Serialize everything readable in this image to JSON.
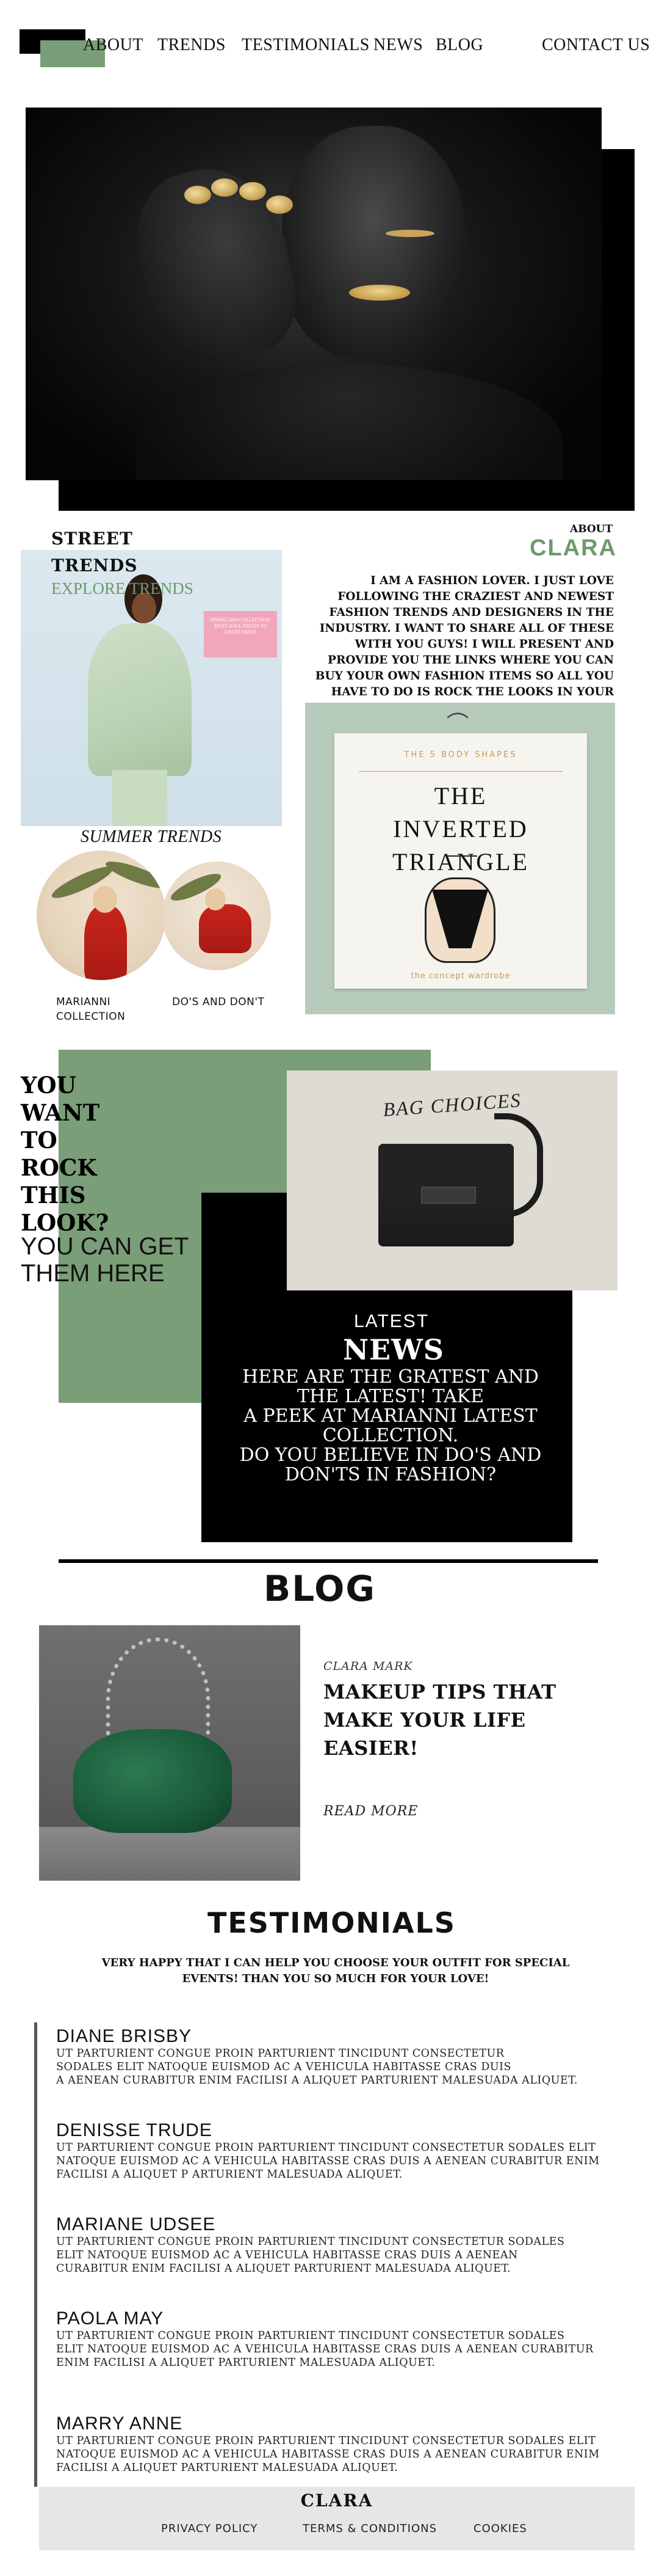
{
  "nav": {
    "items": [
      "ABOUT",
      "TRENDS",
      "TESTIMONIALS",
      "NEWS",
      "BLOG"
    ],
    "contact": "CONTACT US"
  },
  "street": {
    "title_line1": "STREET",
    "title_line2": "TRENDS",
    "explore": "EXPLORE TRENDS",
    "tag_text": "SPRING 2024 COLLECTION. MUST HAVE PIECES TO GREAT DRESS"
  },
  "summer": {
    "title": "SUMMER TRENDS",
    "items": [
      {
        "label_line1": "MARIANNI",
        "label_line2": "COLLECTION"
      },
      {
        "label_line1": "DO'S AND DON'T",
        "label_line2": ""
      }
    ]
  },
  "about": {
    "label": "ABOUT",
    "name": "CLARA",
    "text": "I AM A FASHION LOVER. I JUST LOVE FOLLOWING THE CRAZIEST AND NEWEST FASHION TRENDS AND DESIGNERS IN THE INDUSTRY. I WANT TO SHARE ALL OF THESE WITH YOU GUYS! I WILL PRESENT AND PROVIDE YOU THE LINKS WHERE YOU CAN BUY YOUR OWN FASHION ITEMS SO ALL YOU HAVE TO DO IS ROCK THE LOOKS IN YOUR OWN PERSONAL WAY!"
  },
  "body_shapes": {
    "small": "THE 5 BODY SHAPES",
    "title_line1": "THE",
    "title_line2": "INVERTED",
    "title_line3": "TRIANGLE",
    "footer": "the concept wardrobe"
  },
  "rock": {
    "lines": [
      "YOU",
      "WANT",
      "TO",
      "ROCK",
      "THIS",
      "LOOK?"
    ],
    "sub_line1": "YOU CAN GET",
    "sub_line2": "THEM HERE"
  },
  "bag": {
    "title": "BAG CHOICES"
  },
  "news": {
    "latest": "LATEST",
    "title": "NEWS",
    "line1": "HERE ARE THE GRATEST AND THE LATEST! TAKE",
    "line2": "A PEEK AT MARIANNI LATEST COLLECTION.",
    "line3": "DO YOU BELIEVE IN DO'S AND DON'TS IN FASHION?"
  },
  "blog": {
    "title": "BLOG",
    "author": "CLARA MARK",
    "headline": "MAKEUP TIPS THAT MAKE YOUR LIFE EASIER!",
    "read_more": "READ MORE"
  },
  "testimonials": {
    "title": "TESTIMONIALS",
    "intro": "VERY HAPPY THAT I CAN HELP YOU CHOOSE YOUR OUTFIT FOR SPECIAL EVENTS! THAN YOU SO MUCH FOR YOUR LOVE!",
    "items": [
      {
        "name": "DIANE BRISBY",
        "l1": "UT PARTURIENT CONGUE PROIN PARTURIENT TINCIDUNT CONSECTETUR",
        "l2": "SODALES ELIT NATOQUE EUISMOD AC A VEHICULA HABITASSE CRAS DUIS",
        "l3": "A AENEAN CURABITUR ENIM FACILISI A ALIQUET PARTURIENT MALESUADA ALIQUET."
      },
      {
        "name": "DENISSE TRUDE",
        "l1": "UT PARTURIENT CONGUE PROIN PARTURIENT TINCIDUNT CONSECTETUR SODALES ELIT",
        "l2": "NATOQUE EUISMOD AC A VEHICULA HABITASSE CRAS DUIS A AENEAN CURABITUR ENIM",
        "l3": "FACILISI A ALIQUET P ARTURIENT MALESUADA ALIQUET."
      },
      {
        "name": "MARIANE UDSEE",
        "l1": "UT PARTURIENT CONGUE PROIN PARTURIENT TINCIDUNT CONSECTETUR SODALES",
        "l2": " ELIT NATOQUE EUISMOD AC A VEHICULA HABITASSE CRAS DUIS A AENEAN",
        "l3": "CURABITUR ENIM FACILISI A ALIQUET PARTURIENT MALESUADA ALIQUET."
      },
      {
        "name": "PAOLA MAY",
        "l1": "UT PARTURIENT CONGUE PROIN PARTURIENT TINCIDUNT CONSECTETUR SODALES",
        "l2": "ELIT NATOQUE EUISMOD AC A VEHICULA HABITASSE CRAS DUIS A AENEAN CURABITUR",
        "l3": "ENIM FACILISI A ALIQUET PARTURIENT MALESUADA ALIQUET."
      },
      {
        "name": "MARRY ANNE",
        "l1": "UT PARTURIENT CONGUE PROIN PARTURIENT TINCIDUNT CONSECTETUR SODALES ELIT",
        "l2": "NATOQUE EUISMOD AC A VEHICULA HABITASSE CRAS DUIS A AENEAN CURABITUR ENIM",
        "l3": " FACILISI A ALIQUET PARTURIENT MALESUADA ALIQUET."
      }
    ]
  },
  "footer": {
    "name": "CLARA",
    "links": [
      "PRIVACY POLICY",
      "TERMS & CONDITIONS",
      "COOKIES"
    ]
  },
  "colors": {
    "accent_green": "#7a9e78",
    "black": "#000000",
    "footer_bg": "#e6e6e6",
    "shape_bg": "#b7cbbd"
  }
}
